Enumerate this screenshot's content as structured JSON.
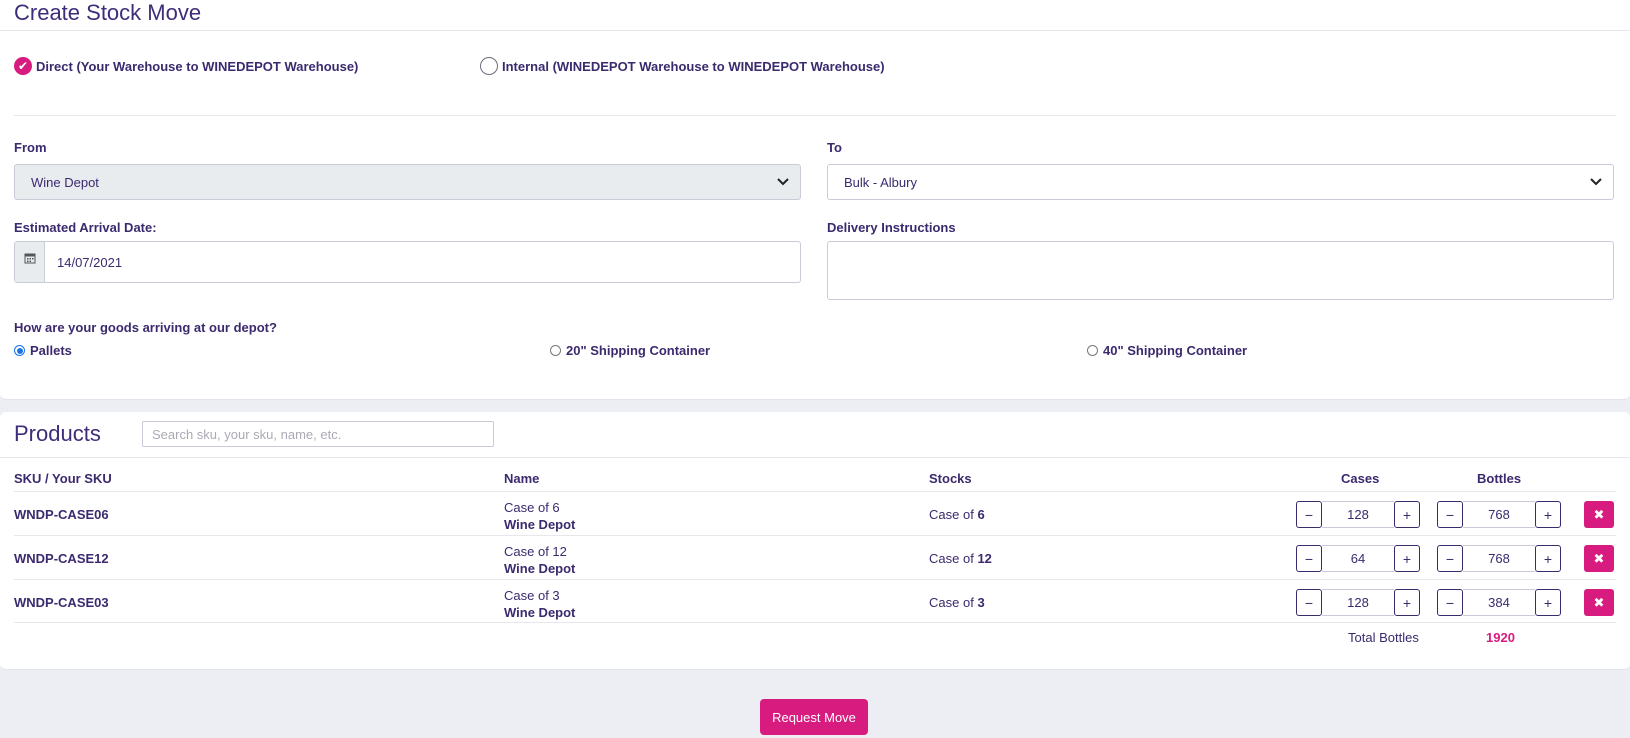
{
  "page": {
    "title": "Create Stock Move"
  },
  "move_type": {
    "direct_label": "Direct (Your Warehouse to WINEDEPOT Warehouse)",
    "internal_label": "Internal (WINEDEPOT Warehouse to WINEDEPOT Warehouse)",
    "selected": "direct"
  },
  "from": {
    "label": "From",
    "value": "Wine Depot"
  },
  "to": {
    "label": "To",
    "value": "Bulk - Albury"
  },
  "arrival": {
    "label": "Estimated Arrival Date:",
    "value": "14/07/2021"
  },
  "delivery": {
    "label": "Delivery Instructions",
    "value": ""
  },
  "arriving": {
    "question": "How are your goods arriving at our depot?",
    "options": [
      "Pallets",
      "20\" Shipping Container",
      "40\" Shipping Container"
    ],
    "selected": "Pallets"
  },
  "products": {
    "title": "Products",
    "search_placeholder": "Search sku, your sku, name, etc.",
    "headers": {
      "sku": "SKU / Your SKU",
      "name": "Name",
      "stocks": "Stocks",
      "cases": "Cases",
      "bottles": "Bottles"
    },
    "rows": [
      {
        "sku": "WNDP-CASE06",
        "name": "Case of 6",
        "brand": "Wine Depot",
        "stock_prefix": "Case of",
        "stock_qty": "6",
        "cases": "128",
        "bottles": "768"
      },
      {
        "sku": "WNDP-CASE12",
        "name": "Case of 12",
        "brand": "Wine Depot",
        "stock_prefix": "Case of",
        "stock_qty": "12",
        "cases": "64",
        "bottles": "768"
      },
      {
        "sku": "WNDP-CASE03",
        "name": "Case of 3",
        "brand": "Wine Depot",
        "stock_prefix": "Case of",
        "stock_qty": "3",
        "cases": "128",
        "bottles": "384"
      }
    ],
    "total_label": "Total Bottles",
    "total_value": "1920"
  },
  "actions": {
    "request_label": "Request Move"
  },
  "colors": {
    "accent": "#d81b7e",
    "text": "#3b2a6e",
    "background": "#eceef4"
  }
}
